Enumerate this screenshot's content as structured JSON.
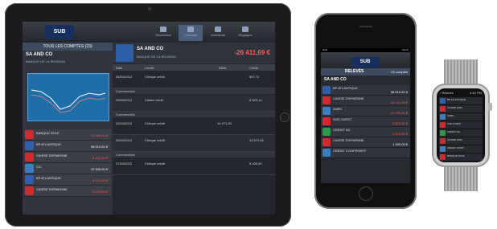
{
  "ipad": {
    "nav": [
      {
        "label": "Recherche",
        "active": false
      },
      {
        "label": "Comptes",
        "active": true
      },
      {
        "label": "Virements",
        "active": false
      },
      {
        "label": "Réglages",
        "active": false
      }
    ],
    "left_header": "TOUS LES COMPTES (23)",
    "selected_account": "SA        AND CO",
    "account_sub": "BANQUE DE LA REUNION",
    "balance": "-26 411,69 €",
    "columns": [
      "Date",
      "Libellé",
      "Débit",
      "Crédit"
    ],
    "accounts": [
      {
        "name": "BANQUE SOLE",
        "amount": "-12 045,00 €",
        "color": "#d22a2a"
      },
      {
        "name": "BP ATLANTIQUE",
        "amount": "98 510,51 €",
        "color": "#2f5fb0"
      },
      {
        "name": "CAISSE D'EPARGNE",
        "amount": "-8 400,00 €",
        "color": "#d22a2a"
      },
      {
        "name": "CIC",
        "amount": "12 305,00 €",
        "color": "#3a7fc4"
      },
      {
        "name": "BP ATLANTIQUE",
        "amount": "-6 212,00 €",
        "color": "#2f5fb0"
      },
      {
        "name": "CAISSE D'EPARGNE",
        "amount": "-3 070,00 €",
        "color": "#d22a2a"
      }
    ],
    "transactions": [
      {
        "date": "26/04/2012",
        "label": "Chèque crédit",
        "debit": "",
        "credit": "507,72"
      },
      {
        "date": "26/04/2012",
        "label": "Cartes crédit",
        "debit": "",
        "credit": "6 903,14"
      },
      {
        "date": "26/04/2012",
        "label": "Chèque crédit",
        "debit": "14 071,30",
        "credit": ""
      },
      {
        "date": "26/04/2012",
        "label": "Chèque crédit",
        "debit": "",
        "credit": "14 571,62"
      },
      {
        "date": "27/04/2012",
        "label": "Chèque crédit",
        "debit": "",
        "credit": "5 005,00"
      }
    ],
    "comment_label": "Commentaire"
  },
  "iphone": {
    "status_left": "SFR",
    "status_right": "100 %",
    "title": "RELEVÉS",
    "count": "23 comptes",
    "account": "SA        AND CO",
    "rows": [
      {
        "name": "BP ATLANTIQUE",
        "amount": "98 510,51 €",
        "color": "#2f5fb0",
        "amount_color": "#ffffff"
      },
      {
        "name": "CAISSE D'EPARGNE",
        "amount": "-26 411,69 €",
        "color": "#d22a2a",
        "amount_color": "#ff5a5a"
      },
      {
        "name": "SUBS",
        "amount": "-12 095,00 €",
        "color": "#3a7fc4",
        "amount_color": "#ff5a5a"
      },
      {
        "name": "SUD OUEST",
        "amount": "-8 512,00 €",
        "color": "#d22a2a",
        "amount_color": "#ff5a5a"
      },
      {
        "name": "CREDIT AG",
        "amount": "-2 310,00 €",
        "color": "#2e9a4a",
        "amount_color": "#ff5a5a"
      },
      {
        "name": "CAISSE D'EPARGNE",
        "amount": "1 450,00 €",
        "color": "#d22a2a",
        "amount_color": "#ffffff"
      },
      {
        "name": "CREDIT COOPERATIF",
        "amount": "",
        "color": "#3a7fc4",
        "amount_color": "#ffffff"
      }
    ]
  },
  "watch": {
    "left": "‹ Relevés",
    "time": "4:42 PM",
    "rows": [
      {
        "name": "BP ATLANTIQUE",
        "color": "#2f5fb0"
      },
      {
        "name": "CAISSE D'EP.",
        "color": "#d22a2a"
      },
      {
        "name": "SUBS",
        "color": "#3a7fc4"
      },
      {
        "name": "SUD OUEST",
        "color": "#d22a2a"
      },
      {
        "name": "CREDIT AG",
        "color": "#2e9a4a"
      },
      {
        "name": "CAISSE D'EP.",
        "color": "#d22a2a"
      },
      {
        "name": "CREDIT COOP.",
        "color": "#3a7fc4"
      },
      {
        "name": "BANQUE SOLE",
        "color": "#d22a2a"
      }
    ]
  }
}
